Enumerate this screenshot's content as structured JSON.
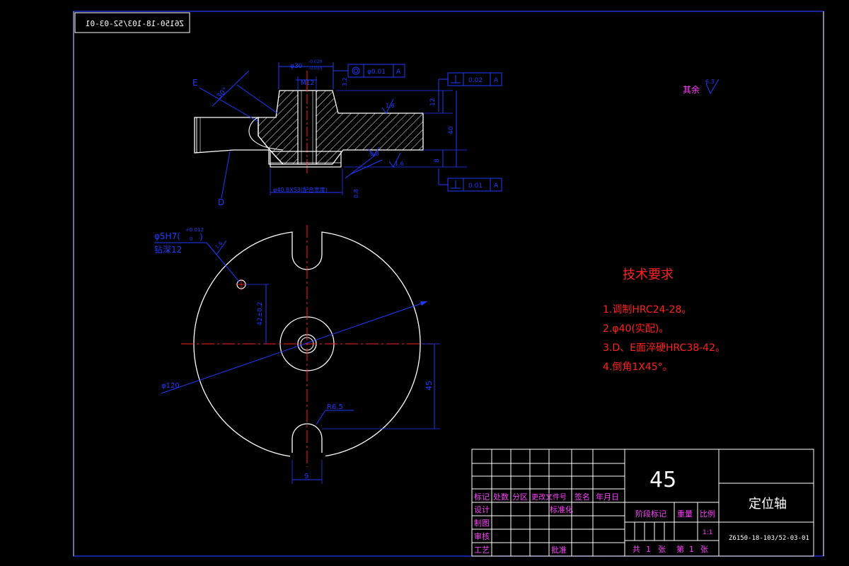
{
  "drawing": {
    "mirrored_code": "Z6150-18-103/52-03-01",
    "roughness_note": "其余",
    "roughness_value": "6.3"
  },
  "section_view": {
    "dia_top_label": "φ30",
    "dia_top_tol_upper": "-0.020",
    "dia_top_tol_lower": "-0.033",
    "thread_label": "M12",
    "concentricity_value": "φ0.01",
    "concentricity_datum": "A",
    "top_perp_value": "0.02",
    "top_perp_datum": "A",
    "bottom_perp_value": "0.01",
    "bottom_perp_datum": "A",
    "chamfer_label": "30°",
    "rough_a": "1.6",
    "rough_b": "1.6",
    "rough_c": "0.8",
    "rough_d": "0.8",
    "rough_e": "3.2",
    "dim_12": "12",
    "dim_40": "40",
    "dim_8": "8",
    "bottom_dia_label": "φ40.8X53(配合宽度)",
    "label_E": "E",
    "label_D": "D"
  },
  "plan_view": {
    "hole_label": "φ5H7(",
    "hole_tol_upper": "+0.012",
    "hole_tol_lower": "0",
    "hole_depth": "钻深12",
    "hole_rough": "1.6",
    "dia_label": "φ120",
    "dim_42": "42±0.2",
    "dim_45": "45",
    "radius_label": "R6.5",
    "slot_width": "9"
  },
  "tech_requirements": {
    "title": "技术要求",
    "items": [
      "1.调制HRC24-28。",
      "2.φ40(实配)。",
      "3.D、E面淬硬HRC38-42。",
      "4.倒角1X45°。"
    ]
  },
  "title_block": {
    "material": "45",
    "part_name": "定位轴",
    "drawing_no": "Z6150-18-103/52-03-01",
    "headers": [
      "标记",
      "处数",
      "分区",
      "更改文件号",
      "签名",
      "年月日"
    ],
    "row_design": "设计",
    "row_standard": "标准化",
    "row_drawing": "制图",
    "row_review": "审核",
    "row_process": "工艺",
    "row_approve": "批准",
    "stage_mark": "阶段标记",
    "weight": "重量",
    "scale_label": "比例",
    "scale_value": "1:1",
    "sheets_total_prefix": "共",
    "sheets_total": "1",
    "sheets_unit": "张",
    "sheet_no_prefix": "第",
    "sheet_no": "1",
    "sheet_unit": "张"
  },
  "colors": {
    "background": "#000000",
    "outline": "#ffffff",
    "dimension": "#1f3bff",
    "centerline": "#ff2020",
    "hatch": "#ffffff",
    "requirements_text": "#ff2020",
    "table_text": "#ff40ff",
    "border": "#1f3bff"
  }
}
